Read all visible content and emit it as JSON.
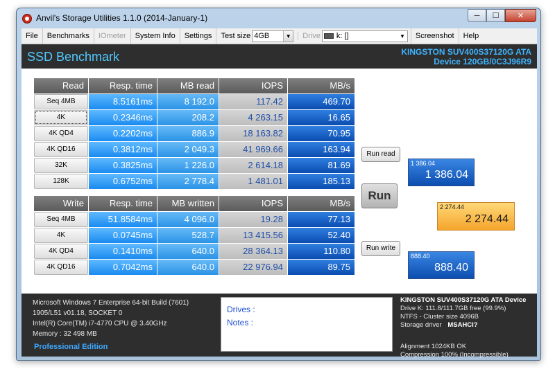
{
  "window": {
    "title": "Anvil's Storage Utilities 1.1.0 (2014-January-1)",
    "min": "─",
    "max": "☐",
    "close": "✕"
  },
  "menu": {
    "file": "File",
    "benchmarks": "Benchmarks",
    "iometer": "IOmeter",
    "sysinfo": "System Info",
    "settings": "Settings",
    "testsize_label": "Test size",
    "testsize_value": "4GB",
    "drive_label": "Drive",
    "drive_value": "k: []",
    "screenshot": "Screenshot",
    "help": "Help"
  },
  "header": {
    "title": "SSD Benchmark",
    "device_line1": "KINGSTON SUV400S37120G ATA",
    "device_line2": "Device 120GB/0C3J96R9"
  },
  "read": {
    "headers": [
      "Read",
      "Resp. time",
      "MB read",
      "IOPS",
      "MB/s"
    ],
    "rows": [
      [
        "Seq 4MB",
        "8.5161ms",
        "8 192.0",
        "117.42",
        "469.70"
      ],
      [
        "4K",
        "0.2346ms",
        "208.2",
        "4 263.15",
        "16.65"
      ],
      [
        "4K QD4",
        "0.2202ms",
        "886.9",
        "18 163.82",
        "70.95"
      ],
      [
        "4K QD16",
        "0.3812ms",
        "2 049.3",
        "41 969.66",
        "163.94"
      ],
      [
        "32K",
        "0.3825ms",
        "1 226.0",
        "2 614.18",
        "81.69"
      ],
      [
        "128K",
        "0.6752ms",
        "2 778.4",
        "1 481.01",
        "185.13"
      ]
    ]
  },
  "write": {
    "headers": [
      "Write",
      "Resp. time",
      "MB written",
      "IOPS",
      "MB/s"
    ],
    "rows": [
      [
        "Seq 4MB",
        "51.8584ms",
        "4 096.0",
        "19.28",
        "77.13"
      ],
      [
        "4K",
        "0.0745ms",
        "528.7",
        "13 415.56",
        "52.40"
      ],
      [
        "4K QD4",
        "0.1410ms",
        "640.0",
        "28 364.13",
        "110.80"
      ],
      [
        "4K QD16",
        "0.7042ms",
        "640.0",
        "22 976.94",
        "89.75"
      ]
    ]
  },
  "buttons": {
    "run_read": "Run read",
    "run": "Run",
    "run_write": "Run write"
  },
  "scores": {
    "read_small": "1 386.04",
    "read_big": "1 386.04",
    "total_small": "2 274.44",
    "total_big": "2 274.44",
    "write_small": "888.40",
    "write_big": "888.40"
  },
  "footer": {
    "sys": [
      "Microsoft Windows 7 Enterprise  64-bit Build (7601)",
      "1905/L51 v01.18, SOCKET 0",
      "Intel(R) Core(TM) i7-4770 CPU @ 3.40GHz",
      "Memory : 32 498 MB"
    ],
    "edition": "Professional Edition",
    "drives_label": "Drives :",
    "notes_label": "Notes :",
    "dev_title": "KINGSTON SUV400S37120G ATA Device",
    "dev_lines": [
      "Drive K: 111.8/111.7GB free (99.9%)",
      "NTFS - Cluster size 4096B"
    ],
    "storage_driver_label": "Storage driver",
    "storage_driver_value": "MSAHCI?",
    "align": "Alignment 1024KB OK",
    "compression": "Compression 100% (Incompressible)"
  }
}
